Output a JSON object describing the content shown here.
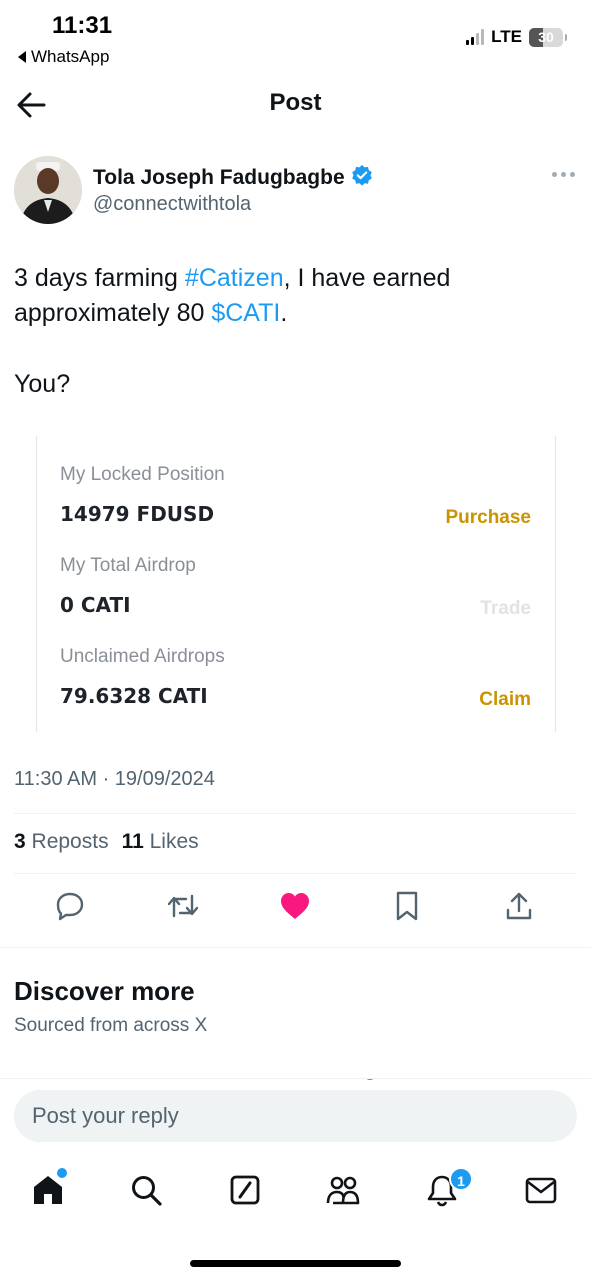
{
  "status_bar": {
    "time": "11:31",
    "back_app": "WhatsApp",
    "network": "LTE",
    "battery": "30"
  },
  "header": {
    "title": "Post"
  },
  "author": {
    "name": "Tola Joseph Fadugbagbe",
    "handle": "@connectwithtola",
    "verified": true
  },
  "tweet": {
    "t1": "3 days farming ",
    "hashtag": "#Catizen",
    "t2": ", I have earned",
    "t3": "approximately 80 ",
    "cashtag": "$CATI",
    "t4": ".",
    "line2": "You?"
  },
  "embed": {
    "rows": [
      {
        "label": "My Locked Position",
        "value": "14979 FDUSD",
        "action": "Purchase",
        "action_color": "#c99400"
      },
      {
        "label": "My Total Airdrop",
        "value": "0 CATI",
        "action": "Trade",
        "action_color": "#e0e2e5"
      },
      {
        "label": "Unclaimed Airdrops",
        "value": "79.6328 CATI",
        "action": "Claim",
        "action_color": "#c99400"
      }
    ]
  },
  "timestamp": "11:30 AM · 19/09/2024",
  "stats": {
    "reposts_count": "3",
    "reposts_label": "Reposts",
    "likes_count": "11",
    "likes_label": "Likes"
  },
  "colors": {
    "accent": "#1d9bf0",
    "like": "#f91880",
    "gold": "#c99400"
  },
  "actions": [
    "reply-icon",
    "repost-icon",
    "like-icon",
    "bookmark-icon",
    "share-icon"
  ],
  "discover": {
    "title": "Discover more",
    "subtitle": "Sourced from across X"
  },
  "reply": {
    "placeholder": "Post your reply"
  },
  "nav": {
    "items": [
      "home-icon",
      "search-icon",
      "grok-icon",
      "communities-icon",
      "notifications-icon",
      "messages-icon"
    ],
    "notification_badge": "1"
  }
}
